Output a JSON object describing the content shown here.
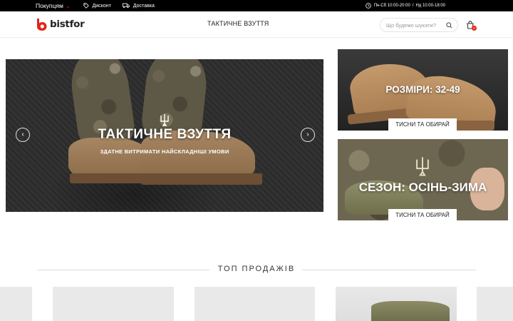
{
  "topbar": {
    "menu_label": "Покупцям",
    "discount_label": "Дисконт",
    "delivery_label": "Доставка",
    "hours_weekdays": "Пн-Сб 10:00-20:00",
    "hours_sunday": "Нд 10:00-18:00",
    "hours_separator": "/"
  },
  "header": {
    "logo_text": "bistfor",
    "nav_title": "ТАКТИЧНЕ ВЗУТТЯ",
    "search_placeholder": "Що будемо шукати?",
    "cart_count": "0"
  },
  "hero": {
    "title": "ТАКТИЧНЕ ВЗУТТЯ",
    "subtitle": "ЗДАТНЕ ВИТРИМАТИ НАЙСКЛАДНІШІ УМОВИ",
    "prev_icon": "‹",
    "next_icon": "›"
  },
  "promos": [
    {
      "title": "РОЗМІРИ: 32-49",
      "button": "ТИСНИ ТА ОБИРАЙ"
    },
    {
      "title": "СЕЗОН: ОСІНЬ-ЗИМА",
      "button": "ТИСНИ ТА ОБИРАЙ"
    }
  ],
  "section": {
    "title": "ТОП ПРОДАЖІВ"
  },
  "colors": {
    "accent": "#e2231a",
    "topbar_bg": "#000000"
  },
  "icons": [
    "chevron-down-icon",
    "tag-icon",
    "truck-icon",
    "clock-icon",
    "search-icon",
    "cart-icon",
    "trident-icon",
    "arrow-left-icon",
    "arrow-right-icon"
  ]
}
